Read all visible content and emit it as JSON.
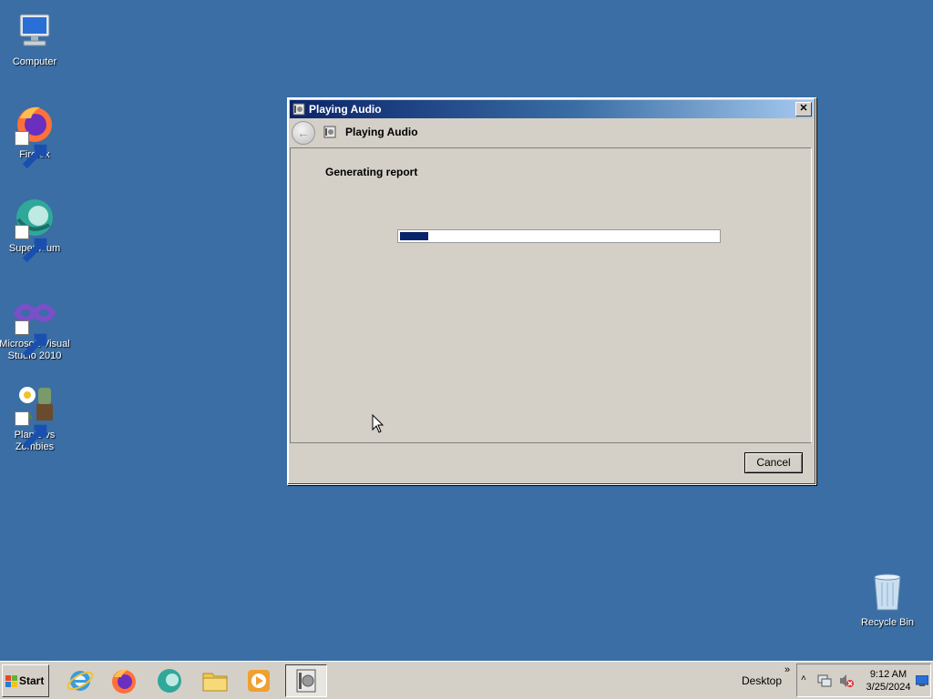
{
  "desktop": {
    "icons": [
      {
        "label": "Computer",
        "icon": "computer-icon"
      },
      {
        "label": "Firefox",
        "icon": "firefox-icon"
      },
      {
        "label": "Supermium",
        "icon": "supermium-icon"
      },
      {
        "label": "Microsoft Visual Studio 2010",
        "icon": "visual-studio-icon"
      },
      {
        "label": "Plants vs Zombies",
        "icon": "plants-vs-zombies-icon"
      },
      {
        "label": "Recycle Bin",
        "icon": "recycle-bin-icon"
      }
    ]
  },
  "dialog": {
    "title": "Playing Audio",
    "close_label": "✕",
    "nav_title": "Playing Audio",
    "status": "Generating report",
    "progress": 0.09,
    "cancel_label": "Cancel"
  },
  "taskbar": {
    "start_label": "Start",
    "desktop_label": "Desktop",
    "chevron": "»",
    "tray_up": "˄",
    "time": "9:12 AM",
    "date": "3/25/2024"
  },
  "colors": {
    "desktop": "#3a6ea5",
    "title_start": "#0a246a",
    "progress_fill": "#0a246a",
    "face": "#d4d0c8"
  }
}
